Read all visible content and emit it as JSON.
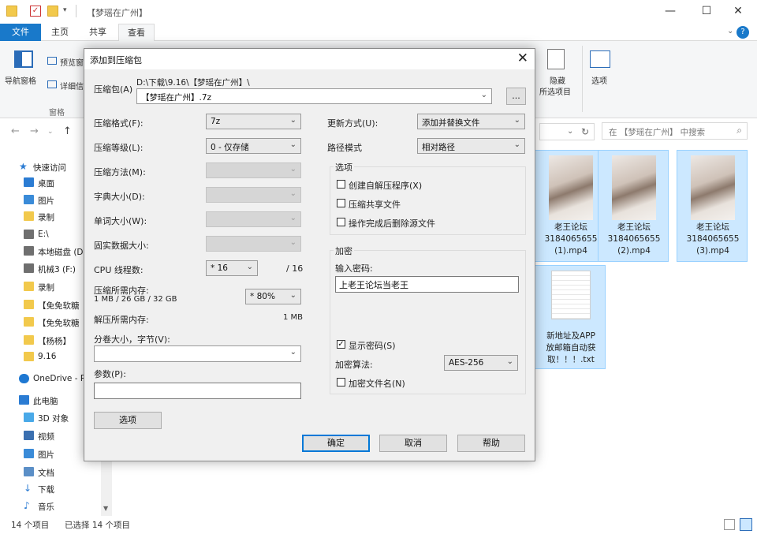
{
  "explorer": {
    "window_title": "【梦瑶在广州】",
    "tabs": [
      "文件",
      "主页",
      "共享",
      "查看"
    ],
    "active_tab": "查看",
    "ribbon": {
      "nav_pane": "导航窗格",
      "preview": "预览窗",
      "details": "详细信",
      "group_pane": "窗格",
      "hide_selected_line1": "隐藏",
      "hide_selected_line2": "所选项目",
      "options": "选项"
    },
    "search_placeholder": "在 【梦瑶在广州】 中搜索",
    "nav_items": [
      {
        "label": "快速访问",
        "icon": "star-icon"
      },
      {
        "label": "桌面",
        "icon": "desktop-icon"
      },
      {
        "label": "图片",
        "icon": "pictures-icon"
      },
      {
        "label": "录制",
        "icon": "folder-icon"
      },
      {
        "label": "E:\\",
        "icon": "drive-icon"
      },
      {
        "label": "本地磁盘 (D",
        "icon": "drive-icon"
      },
      {
        "label": "机械3 (F:)",
        "icon": "drive-icon"
      },
      {
        "label": "录制",
        "icon": "folder-icon"
      },
      {
        "label": "【免免软糖",
        "icon": "folder-icon"
      },
      {
        "label": "【免免软糖",
        "icon": "folder-icon"
      },
      {
        "label": "【杨杨】",
        "icon": "folder-icon"
      },
      {
        "label": "9.16",
        "icon": "folder-icon"
      },
      {
        "label": "OneDrive - P",
        "icon": "cloud-icon"
      },
      {
        "label": "此电脑",
        "icon": "computer-icon"
      },
      {
        "label": "3D 对象",
        "icon": "cube-icon"
      },
      {
        "label": "视频",
        "icon": "video-icon"
      },
      {
        "label": "图片",
        "icon": "pictures-icon"
      },
      {
        "label": "文档",
        "icon": "document-icon"
      },
      {
        "label": "下载",
        "icon": "download-icon"
      },
      {
        "label": "音乐",
        "icon": "music-icon"
      }
    ],
    "files": [
      {
        "name_line1": "老王论坛",
        "name_line2": "3184065655",
        "name_line3": "(1).mp4"
      },
      {
        "name_line1": "老王论坛",
        "name_line2": "3184065655",
        "name_line3": "(2).mp4"
      },
      {
        "name_line1": "老王论坛",
        "name_line2": "3184065655",
        "name_line3": "(3).mp4"
      },
      {
        "name_line1": "新地址及APP",
        "name_line2": "放邮箱自动获",
        "name_line3": "取！！！.txt"
      }
    ],
    "status_count": "14 个项目",
    "status_selected": "已选择 14 个项目"
  },
  "dialog": {
    "title": "添加到压缩包",
    "archive_label": "压缩包(A)",
    "archive_path": "D:\\下载\\9.16\\【梦瑶在广州】\\",
    "archive_name": "【梦瑶在广州】.7z",
    "browse_label": "...",
    "format_label": "压缩格式(F):",
    "format_value": "7z",
    "level_label": "压缩等级(L):",
    "level_value": "0 - 仅存储",
    "method_label": "压缩方法(M):",
    "dict_label": "字典大小(D):",
    "word_label": "单词大小(W):",
    "solid_label": "固实数据大小:",
    "threads_label": "CPU 线程数:",
    "threads_value": "* 16",
    "threads_max": "/ 16",
    "mem_comp_label": "压缩所需内存:",
    "mem_comp_value": "1 MB / 26 GB / 32 GB",
    "mem_percent": "* 80%",
    "mem_decomp_label": "解压所需内存:",
    "mem_decomp_value": "1 MB",
    "split_label": "分卷大小，字节(V):",
    "params_label": "参数(P):",
    "options_button": "选项",
    "update_label": "更新方式(U):",
    "update_value": "添加并替换文件",
    "path_label": "路径模式",
    "path_value": "相对路径",
    "options_group": "选项",
    "opt_sfx": "创建自解压程序(X)",
    "opt_shared": "压缩共享文件",
    "opt_delete": "操作完成后删除源文件",
    "encrypt_group": "加密",
    "password_label": "输入密码:",
    "password_value": "上老王论坛当老王",
    "show_password": "显示密码(S)",
    "enc_method_label": "加密算法:",
    "enc_method_value": "AES-256",
    "enc_names": "加密文件名(N)",
    "ok": "确定",
    "cancel": "取消",
    "help": "帮助"
  }
}
